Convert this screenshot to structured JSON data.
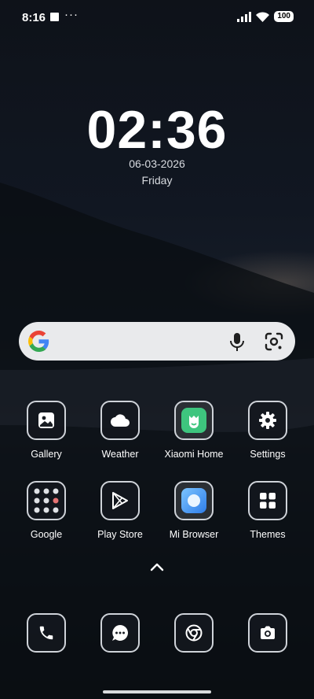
{
  "status_bar": {
    "time": "8:16",
    "more": "···",
    "battery": "100"
  },
  "lock_clock": {
    "time": "02:36",
    "date": "06-03-2026",
    "day": "Friday"
  },
  "search": {
    "placeholder": ""
  },
  "apps": [
    {
      "label": "Gallery",
      "icon": "gallery-icon"
    },
    {
      "label": "Weather",
      "icon": "weather-icon"
    },
    {
      "label": "Xiaomi Home",
      "icon": "xiaomi-home-icon"
    },
    {
      "label": "Settings",
      "icon": "settings-icon"
    },
    {
      "label": "Google",
      "icon": "google-folder-icon"
    },
    {
      "label": "Play Store",
      "icon": "play-store-icon"
    },
    {
      "label": "Mi Browser",
      "icon": "mi-browser-icon"
    },
    {
      "label": "Themes",
      "icon": "themes-icon"
    }
  ],
  "dock": [
    {
      "icon": "phone-icon"
    },
    {
      "icon": "messages-icon"
    },
    {
      "icon": "chrome-icon"
    },
    {
      "icon": "camera-icon"
    }
  ],
  "colors": {
    "xiaomi_home_green": "#3ec57e",
    "mi_browser_blue": "#4aa3f5",
    "icon_border": "#cfd3d9"
  }
}
